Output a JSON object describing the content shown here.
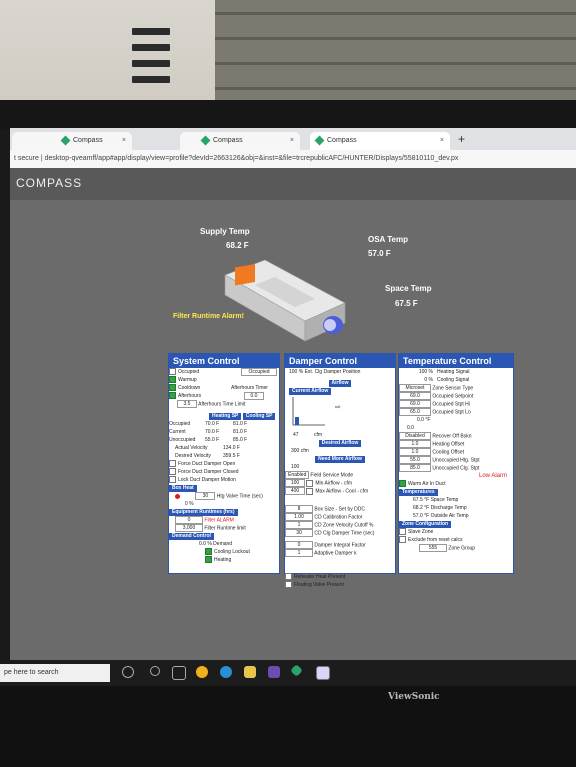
{
  "browser": {
    "tabs": [
      "Compass",
      "Compass",
      "Compass"
    ],
    "address": "t secure  |  desktop-qveamff/app#app/display/view=profile?devId=2663126&obj=&inst=&file=trcrepublicAFC/HUNTER/Displays/55810110_dev.px"
  },
  "app": {
    "brand": "COMPASS"
  },
  "unit": {
    "supply_temp_label": "Supply Temp",
    "supply_temp_value": "68.2 F",
    "osa_temp_label": "OSA Temp",
    "osa_temp_value": "57.0 F",
    "space_temp_label": "Space Temp",
    "space_temp_value": "67.5 F",
    "filter_alarm": "Filter Runtime Alarm!"
  },
  "system_control": {
    "title": "System Control",
    "occupied_label": "Occupied",
    "occupied_select": "Occupied",
    "warmup": "Warmup",
    "cooldown": "Cooldown",
    "afterhours": "Afterhours",
    "afterhours_timer_label": "Afterhours Timer",
    "afterhours_timer": "0.0",
    "afterhours_time_limit": "3.5",
    "afterhours_time_limit_label": "Afterhours Time Limit",
    "heating_sp": "Heating SP",
    "cooling_sp": "Cooling SP",
    "sp_rows": [
      {
        "label": "Occupied",
        "heat": "70.0 F",
        "cool": "81.0 F"
      },
      {
        "label": "Current",
        "heat": "70.0 F",
        "cool": "81.0 F"
      },
      {
        "label": "Unoccupied",
        "heat": "55.0 F",
        "cool": "85.0 F"
      }
    ],
    "actual_velocity": "Actual Velocity",
    "actual_velocity_val": "134.0 F",
    "desired_velocity": "Desired Velocity",
    "desired_velocity_val": "359.5 F",
    "force_open": "Force Duct Damper Open",
    "force_closed": "Force Duct Damper Closed",
    "lock_motion": "Lock Duct Damper Motion",
    "box_heat": "Box Heat",
    "htg_valve_value": "30",
    "htg_valve_label": "Htg Valve Time (sec)",
    "valve_pct": "0 %",
    "equip_runtimes": "Equipment Runtimes (hrs)",
    "filter_val": "0",
    "filter_label": "Filter ALARM",
    "filter_runtime_val": "3,000",
    "filter_runtime_label": "Filter Runtime limit",
    "demand_control": "Demand Control",
    "demand": "0.0 % Demand",
    "cooling_lockout": "Cooling Lockout",
    "heating": "Heating"
  },
  "damper_control": {
    "title": "Damper Control",
    "position": "100 %  Ext. Clg Damper Position",
    "airflow": "Airflow",
    "current_airflow": "Current Airflow",
    "cfm_value": "47",
    "cfm_unit": "cfm",
    "desired_airflow": "Desired Airflow",
    "desired_value": "300 cfm",
    "need_more": "Need More Airflow",
    "need_value": "100",
    "enabled": "Enabled",
    "field_service": "Field Service Mode",
    "min_airflow_val": "100",
    "min_airflow_label": "Min Airflow - cfm",
    "max_airflow_val": "400",
    "max_airflow_label": "Max Airflow - Cool - cfm",
    "settings": [
      {
        "val": "8",
        "label": "Box Size - Set by DDC"
      },
      {
        "val": "1.00",
        "label": "CD Calibration Factor"
      },
      {
        "val": "1",
        "label": "CD Zone Velocity Cutoff %"
      },
      {
        "val": "30",
        "label": "CD Clg Damper Time (sec)"
      },
      {
        "val": "0",
        "label": "Damper Integral Factor"
      },
      {
        "val": "1",
        "label": "Adaptive Damper k"
      }
    ],
    "reheat": "Reheater Heat Present",
    "floating": "Floating Valve Present"
  },
  "temperature_control": {
    "title": "Temperature Control",
    "rows": [
      {
        "val": "100 %",
        "label": "Heating Signal"
      },
      {
        "val": "0 %",
        "label": "Cooling Signal"
      },
      {
        "val": "Microset",
        "label": "Zone Sensor Type"
      },
      {
        "val": "69.0",
        "label": "Occupied Setpoint"
      },
      {
        "val": "69.0",
        "label": "Occupied Stpt Hi"
      },
      {
        "val": "65.0",
        "label": "Occupied Stpt Lo"
      }
    ],
    "pot": "0.0 °F",
    "pot_val": "0.0",
    "disabled": "Disabled",
    "recover": "Recover Off Bskn",
    "offsets": [
      {
        "val": "1.0",
        "label": "Heating Offset"
      },
      {
        "val": "1.0",
        "label": "Cooling Offset"
      },
      {
        "val": "55.0",
        "label": "Unoccupied Htg. Stpt"
      },
      {
        "val": "85.0",
        "label": "Unoccupied Clg. Stpt"
      }
    ],
    "low_alarm": "Low Alarm",
    "warm_air": "Warm Air In Duct",
    "temperatures": "Temperatures",
    "temps": [
      "67.5 °F  Space Temp",
      "68.2 °F  Discharge Temp",
      "57.0 °F  Outside Air Temp"
    ],
    "zone_config": "Zone Configuration",
    "slave_zone": "Slave Zone",
    "exclude": "Exclude from reset calcs",
    "zone_group_val": "555",
    "zone_group": "Zone Group"
  },
  "taskbar": {
    "search": "pe here to search"
  },
  "monitor_brand": "ViewSonic"
}
